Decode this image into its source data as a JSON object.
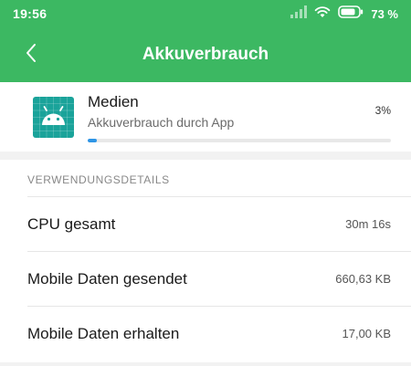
{
  "status_bar": {
    "time": "19:56",
    "battery_percent": "73 %",
    "icons": [
      "signal-icon",
      "wifi-icon",
      "battery-icon"
    ]
  },
  "app_bar": {
    "title": "Akkuverbrauch",
    "back_icon": "chevron-left-icon"
  },
  "app_entry": {
    "name": "Medien",
    "subtitle": "Akkuverbrauch durch App",
    "percent_label": "3%",
    "usage_fraction": 0.03,
    "icon": "android-icon"
  },
  "details": {
    "header": "VERWENDUNGSDETAILS",
    "rows": [
      {
        "label": "CPU gesamt",
        "value": "30m 16s"
      },
      {
        "label": "Mobile Daten gesendet",
        "value": "660,63 KB"
      },
      {
        "label": "Mobile Daten erhalten",
        "value": "17,00 KB"
      }
    ]
  },
  "colors": {
    "accent": "#3cb862",
    "progress": "#2e95e6",
    "app_icon_bg": "#1aa39a"
  }
}
